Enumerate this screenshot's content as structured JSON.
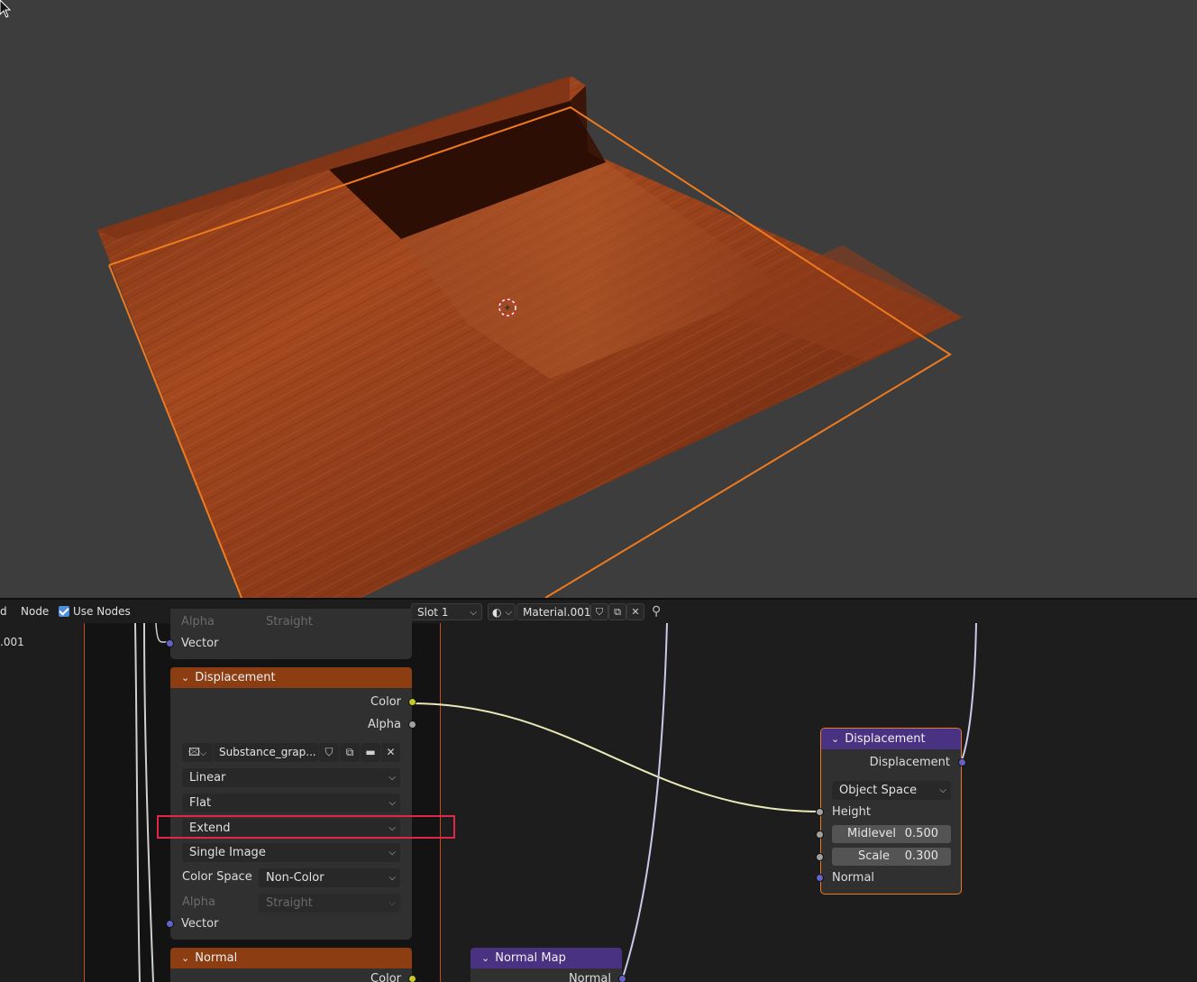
{
  "header": {
    "menu_view_fragment": "d",
    "menu_node": "Node",
    "use_nodes_label": "Use Nodes",
    "use_nodes_checked": true,
    "slot_value": "Slot 1",
    "material_name": "Material.001"
  },
  "side_fragment": ".001",
  "top_image_node": {
    "alpha_label": "Alpha",
    "alpha_value": "Straight",
    "vector_label": "Vector"
  },
  "image_node": {
    "title": "Displacement",
    "out_color": "Color",
    "out_alpha": "Alpha",
    "image_name": "Substance_grap...",
    "interpolation": "Linear",
    "projection": "Flat",
    "extension": "Extend",
    "source": "Single Image",
    "color_space_label": "Color Space",
    "color_space_value": "Non-Color",
    "alpha_label": "Alpha",
    "alpha_value": "Straight",
    "vector_label": "Vector"
  },
  "normal_image_node": {
    "title": "Normal",
    "out_color": "Color"
  },
  "normal_map_node": {
    "title": "Normal Map",
    "out_normal": "Normal"
  },
  "displacement_node": {
    "title": "Displacement",
    "out_displacement": "Displacement",
    "space": "Object Space",
    "height_label": "Height",
    "midlevel_label": "Midlevel",
    "midlevel_value": "0.500",
    "scale_label": "Scale",
    "scale_value": "0.300",
    "normal_label": "Normal"
  },
  "colors": {
    "selection_orange": "#f07a1e",
    "texture_header": "#8c3d12",
    "vector_header": "#4a3283",
    "highlight_red": "#e0264a",
    "wood": "#8a3a1a"
  },
  "icons": [
    "cursor-arrow-icon",
    "3d-cursor-icon",
    "checkbox-icon",
    "chevron-down-icon",
    "sphere-material-icon",
    "shield-icon",
    "duplicate-icon",
    "close-icon",
    "pin-icon",
    "image-icon",
    "folder-icon"
  ]
}
